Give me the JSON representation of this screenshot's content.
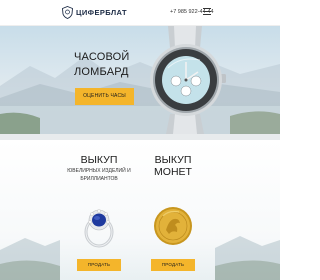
{
  "header": {
    "brand": "ЦИФЕРБЛАТ",
    "logo_icon": "shield-logo-icon",
    "phone": "+7 985 922-44-44",
    "menu_icon": "hamburger-menu-icon"
  },
  "hero": {
    "title_line1": "ЧАСОВОЙ",
    "title_line2": "ЛОМБАРД",
    "button_label": "ОЦЕНИТЬ ЧАСЫ",
    "accent_color": "#f4b52b"
  },
  "cards": [
    {
      "title": "ВЫКУП",
      "subtitle_line1": "ЮВЕЛИРНЫХ ИЗДЕЛИЙ И",
      "subtitle_line2": "БРИЛЛИАНТОВ",
      "button_label": "ПРОДАТЬ",
      "image": "sapphire-ring"
    },
    {
      "title": "ВЫКУП МОНЕТ",
      "button_label": "ПРОДАТЬ",
      "image": "gold-coin"
    }
  ]
}
